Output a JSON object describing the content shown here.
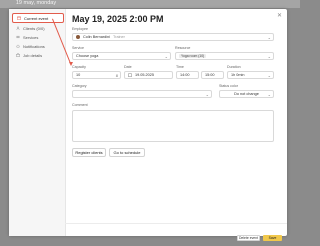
{
  "background": {
    "date_label": "19 may, monday"
  },
  "sidebar": {
    "items": [
      {
        "label": "Current event",
        "icon": "calendar-icon",
        "active": true
      },
      {
        "label": "Clients (0/0)",
        "icon": "users-icon"
      },
      {
        "label": "Services",
        "icon": "list-icon"
      },
      {
        "label": "Notifications",
        "icon": "bell-icon"
      },
      {
        "label": "Job details",
        "icon": "briefcase-icon"
      }
    ]
  },
  "event": {
    "title": "May 19, 2025 2:00 PM",
    "employee_label": "Employee",
    "employee_name": "Colin Bernardini",
    "employee_role": "Trainer",
    "service_label": "Service",
    "service_placeholder": "Choose yoga",
    "resource_label": "Resource",
    "resource_value": "Yoga room (10)",
    "capacity_label": "Capacity",
    "capacity_value": "10",
    "capacity_suffix": "8",
    "date_label": "Date",
    "date_value": "19.05.2025",
    "time_label": "Time",
    "time_from": "14:00",
    "time_to": "15:00",
    "duration_label": "Duration",
    "duration_value": "1h 0min",
    "category_label": "Category",
    "status_label": "Status color",
    "status_value": "Do not change",
    "comment_label": "Comment",
    "register_btn": "Register clients",
    "schedule_btn": "Go to schedule",
    "cancel_btn": "Delete event",
    "save_btn": "Save"
  },
  "colors": {
    "accent": "#e25b4b",
    "save": "#f1c84b"
  }
}
